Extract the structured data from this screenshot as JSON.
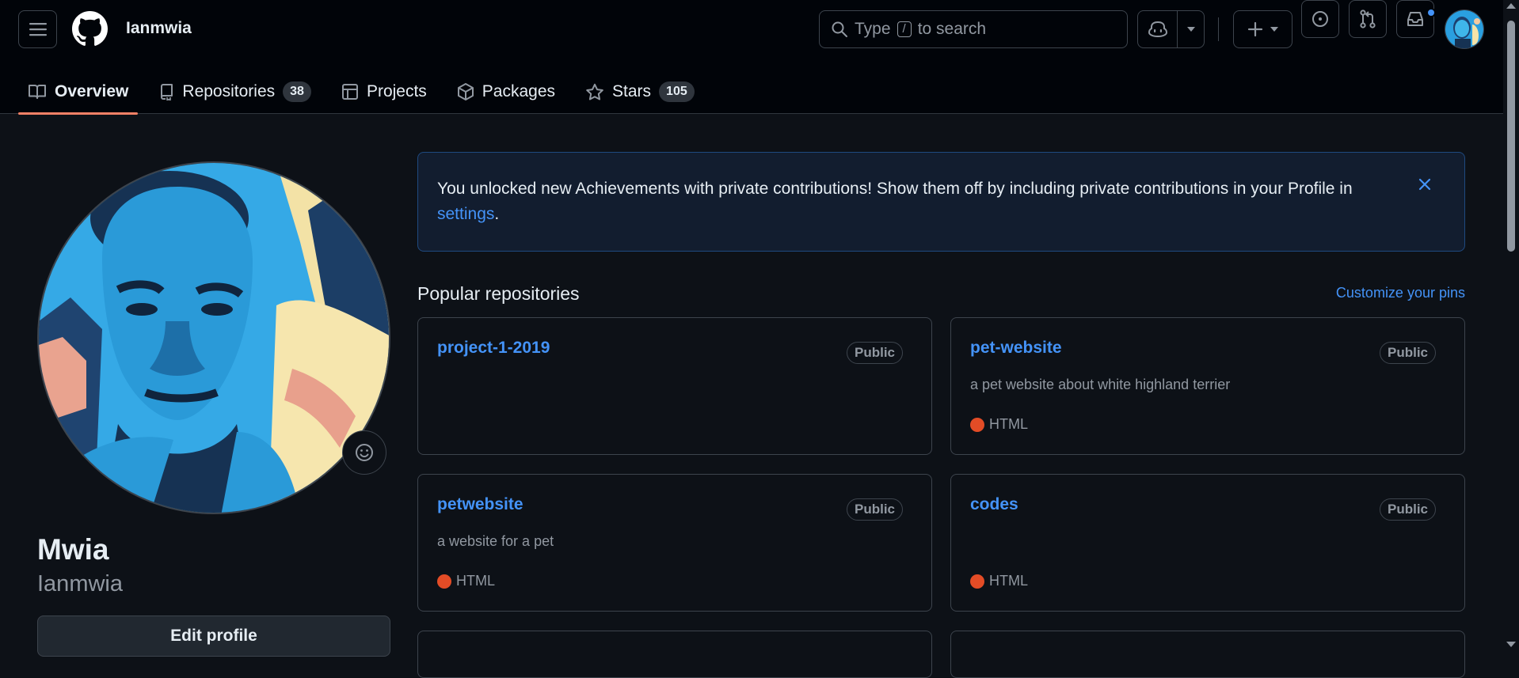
{
  "header": {
    "username": "Ianmwia",
    "search": {
      "prefix": "Type",
      "key": "/",
      "suffix": "to search"
    }
  },
  "tabs": [
    {
      "label": "Overview",
      "icon": "book-icon"
    },
    {
      "label": "Repositories",
      "icon": "repo-icon",
      "count": "38"
    },
    {
      "label": "Projects",
      "icon": "table-icon"
    },
    {
      "label": "Packages",
      "icon": "package-icon"
    },
    {
      "label": "Stars",
      "icon": "star-icon",
      "count": "105"
    }
  ],
  "profile": {
    "full_name": "Mwia",
    "login": "Ianmwia",
    "edit_label": "Edit profile"
  },
  "flash": {
    "text": "You unlocked new Achievements with private contributions! Show them off by including private contributions in your Profile in",
    "link": "settings",
    "end": "."
  },
  "popular": {
    "title": "Popular repositories",
    "customize": "Customize your pins",
    "repos": [
      {
        "name": "project-1-2019",
        "visibility": "Public",
        "description": "",
        "language": ""
      },
      {
        "name": "pet-website",
        "visibility": "Public",
        "description": "a pet website about white highland terrier",
        "language": "HTML"
      },
      {
        "name": "petwebsite",
        "visibility": "Public",
        "description": "a website for a pet",
        "language": "HTML"
      },
      {
        "name": "codes",
        "visibility": "Public",
        "description": "",
        "language": "HTML"
      }
    ]
  },
  "colors": {
    "accent": "#4493f8",
    "tab_underline": "#f78166",
    "html_lang": "#e34c26",
    "background": "#0d1117"
  }
}
